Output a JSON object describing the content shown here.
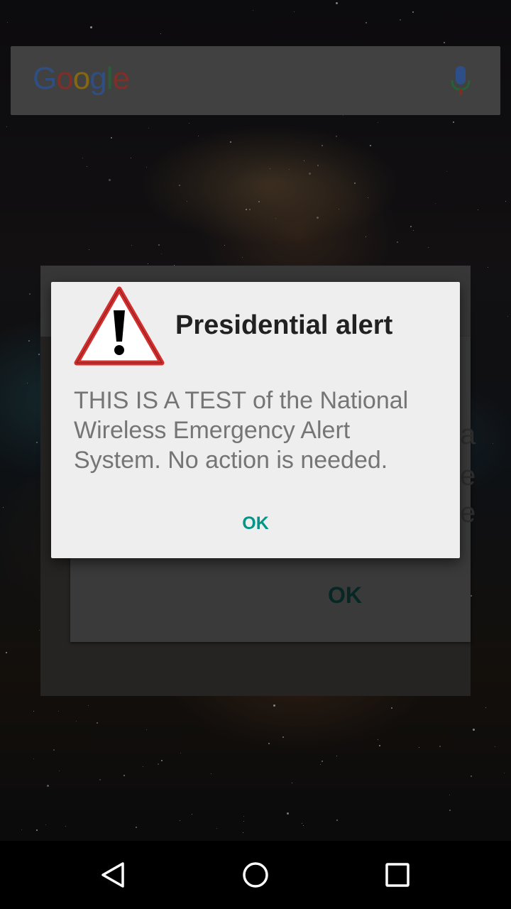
{
  "search": {
    "logo_letters": [
      {
        "char": "G",
        "color": "#4285F4"
      },
      {
        "char": "o",
        "color": "#EA4335"
      },
      {
        "char": "o",
        "color": "#FBBC05"
      },
      {
        "char": "g",
        "color": "#4285F4"
      },
      {
        "char": "l",
        "color": "#34A853"
      },
      {
        "char": "e",
        "color": "#EA4335"
      }
    ],
    "mic_icon": "microphone-icon"
  },
  "background_dialog": {
    "ok_label": "OK",
    "fragments": [
      "a",
      "a",
      "e",
      "e"
    ]
  },
  "alert": {
    "icon": "warning-triangle-icon",
    "title": "Presidential alert",
    "message": "THIS IS A TEST of the National Wireless Emergency Alert System. No action is needed.",
    "ok_label": "OK",
    "accent_color": "#009688"
  },
  "navbar": {
    "back_icon": "back-triangle-icon",
    "home_icon": "home-circle-icon",
    "recents_icon": "recents-square-icon"
  }
}
